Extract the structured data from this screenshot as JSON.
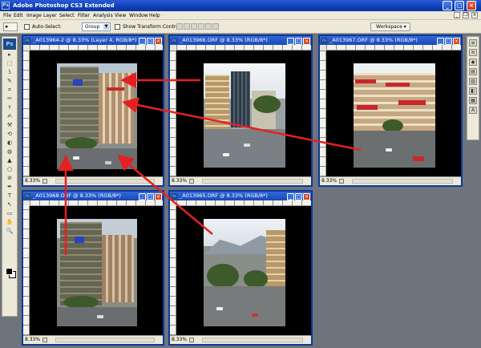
{
  "app": {
    "title": "Adobe Photoshop CS3 Extended",
    "icon_label": "Ps",
    "window_buttons": {
      "minimize": "_",
      "maximize": "□",
      "close": "×"
    }
  },
  "menu": {
    "items": [
      "File",
      "Edit",
      "Image",
      "Layer",
      "Select",
      "Filter",
      "Analysis",
      "View",
      "Window",
      "Help"
    ],
    "doc_controls": {
      "minimize": "_",
      "restore": "❐",
      "close": "×"
    }
  },
  "options": {
    "tool_preset_icon": "move-tool-icon",
    "tool_preset_glyph": "▸",
    "auto_select_label": "Auto-Select:",
    "auto_select_value": "Group",
    "show_transform_label": "Show Transform Controls",
    "workspace_label": "Workspace ▾"
  },
  "toolbox": {
    "logo": "Ps",
    "tools": [
      "▸",
      "⬚",
      "ʖ",
      "✎",
      "⌗",
      "✂",
      "⚕",
      "✍",
      "⚒",
      "⟲",
      "◐",
      "◍",
      "▲",
      "○",
      "⊘",
      "✒",
      "T",
      "↖",
      "▭",
      "✋",
      "🔍"
    ],
    "foreground_color": "#000000",
    "background_color": "#ffffff"
  },
  "dock": {
    "icons": [
      "≡",
      "≋",
      "◆",
      "▤",
      "▥",
      "◧",
      "▦",
      "A"
    ]
  },
  "documents": [
    {
      "title": "_A013964-2 @ 8.33% (Layer 4, RGB/8*)",
      "zoom": "8.33%",
      "active": true
    },
    {
      "title": "_A013966.ORF @ 8.33% (RGB/8*)",
      "zoom": "8.33%",
      "active": false
    },
    {
      "title": "_A013967.ORF @ 8.33% (RGB/8*)",
      "zoom": "8.33%",
      "active": false
    },
    {
      "title": "_A013968.ORF @ 8.33% (RGB/8*)",
      "zoom": "8.33%",
      "active": false
    },
    {
      "title": "_A013965.ORF @ 8.33% (RGB/8*)",
      "zoom": "8.33%",
      "active": false
    }
  ],
  "doc_buttons": {
    "minimize": "_",
    "maximize": "□",
    "close": "×"
  },
  "colors": {
    "title_bar": "#1a48b8",
    "arrow": "#e62020",
    "canvas": "#000000"
  }
}
